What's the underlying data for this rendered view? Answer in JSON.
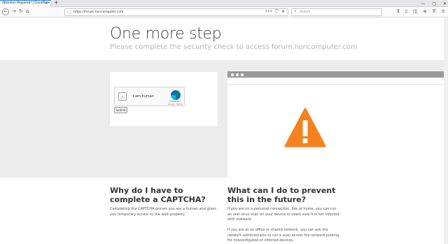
{
  "browser": {
    "tab_title": "Attention Required! | Cloudflare",
    "tab_close": "×",
    "new_tab": "+",
    "window_controls": [
      "—",
      "▢",
      "✕"
    ],
    "url": "https://forum.lioncomputer.com",
    "search_placeholder": "Search",
    "url_actions": [
      "•••",
      "⛉",
      "★"
    ]
  },
  "page": {
    "title": "One more step",
    "subtitle": "Please complete the security check to access forum.lioncomputer.com"
  },
  "captcha": {
    "checkbox_label": "I am human",
    "brand": "hCaptcha",
    "links": "Privacy - Terms",
    "submit_label": "Submit"
  },
  "sections": {
    "why_title": "Why do I have to complete a CAPTCHA?",
    "why_body": "Completing the CAPTCHA proves you are a human and gives you temporary access to the web property.",
    "prevent_title": "What can I do to prevent this in the future?",
    "prevent_body_1": "If you are on a personal connection, like at home, you can run an anti-virus scan on your device to make sure it is not infected with malware.",
    "prevent_body_2": "If you are at an office or shared network, you can ask the network administrator to run a scan across the network looking for misconfigured or infected devices."
  },
  "colors": {
    "warning": "#f6821f",
    "band": "#ececec",
    "accent": "#0a84ff"
  }
}
